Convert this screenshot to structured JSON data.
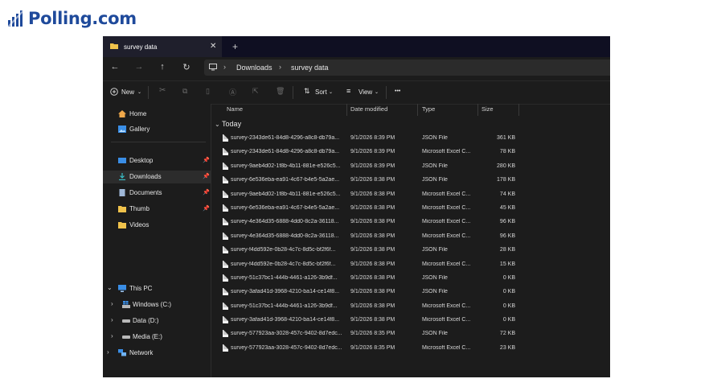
{
  "brand": {
    "text": "Polling.com",
    "color": "#1f4a9b"
  },
  "tab": {
    "title": "survey data",
    "close": "✕",
    "new": "+"
  },
  "nav": {
    "back": "←",
    "forward": "→",
    "up": "↑",
    "refresh": "↻"
  },
  "breadcrumb": {
    "parts": [
      "Downloads",
      "survey data"
    ],
    "sep": "›"
  },
  "toolbar": {
    "new_label": "New",
    "sort_label": "Sort",
    "view_label": "View",
    "more_label": "•••"
  },
  "sidebar": {
    "items": [
      {
        "label": "Home"
      },
      {
        "label": "Gallery"
      },
      {
        "label": "Desktop"
      },
      {
        "label": "Downloads"
      },
      {
        "label": "Documents"
      },
      {
        "label": "Thumb"
      },
      {
        "label": "Videos"
      },
      {
        "label": "This PC"
      },
      {
        "label": "Windows  (C:)"
      },
      {
        "label": "Data (D:)"
      },
      {
        "label": "Media (E:)"
      },
      {
        "label": "Network"
      }
    ]
  },
  "columns": {
    "name": "Name",
    "date": "Date modified",
    "type": "Type",
    "size": "Size"
  },
  "group_label": "Today",
  "files": [
    {
      "name": "survey-2343de61-84d8-4296-a8c8-db79a...",
      "date": "9/1/2026 8:39 PM",
      "type": "JSON File",
      "size": "361 KB"
    },
    {
      "name": "survey-2343de61-84d8-4296-a8c8-db79a...",
      "date": "9/1/2026 8:39 PM",
      "type": "Microsoft Excel C...",
      "size": "78 KB"
    },
    {
      "name": "survey-9aeb4d02-1f8b-4b11-881e-e526c5...",
      "date": "9/1/2026 8:39 PM",
      "type": "JSON File",
      "size": "280 KB"
    },
    {
      "name": "survey-6e536eba-ea91-4c67-b4e5-5a2ae...",
      "date": "9/1/2026 8:38 PM",
      "type": "JSON File",
      "size": "178 KB"
    },
    {
      "name": "survey-9aeb4d02-1f8b-4b11-881e-e526c5...",
      "date": "9/1/2026 8:38 PM",
      "type": "Microsoft Excel C...",
      "size": "74 KB"
    },
    {
      "name": "survey-6e536eba-ea91-4c67-b4e5-5a2ae...",
      "date": "9/1/2026 8:38 PM",
      "type": "Microsoft Excel C...",
      "size": "45 KB"
    },
    {
      "name": "survey-4e364d35-6888-4dd0-8c2a-36118...",
      "date": "9/1/2026 8:38 PM",
      "type": "Microsoft Excel C...",
      "size": "96 KB"
    },
    {
      "name": "survey-4e364d35-6888-4dd0-8c2a-36118...",
      "date": "9/1/2026 8:38 PM",
      "type": "Microsoft Excel C...",
      "size": "96 KB"
    },
    {
      "name": "survey-f4dd592e-0b28-4c7c-8d5c-bf2f6f...",
      "date": "9/1/2026 8:38 PM",
      "type": "JSON File",
      "size": "28 KB"
    },
    {
      "name": "survey-f4dd592e-0b28-4c7c-8d5c-bf2f6f...",
      "date": "9/1/2026 8:38 PM",
      "type": "Microsoft Excel C...",
      "size": "15 KB"
    },
    {
      "name": "survey-51c37bc1-444b-4461-a126-3b9df...",
      "date": "9/1/2026 8:38 PM",
      "type": "JSON File",
      "size": "0 KB"
    },
    {
      "name": "survey-3afad41d-3968-4210-ba14-ce14f8...",
      "date": "9/1/2026 8:38 PM",
      "type": "JSON File",
      "size": "0 KB"
    },
    {
      "name": "survey-51c37bc1-444b-4461-a126-3b9df...",
      "date": "9/1/2026 8:38 PM",
      "type": "Microsoft Excel C...",
      "size": "0 KB"
    },
    {
      "name": "survey-3afad41d-3968-4210-ba14-ce14f8...",
      "date": "9/1/2026 8:38 PM",
      "type": "Microsoft Excel C...",
      "size": "0 KB"
    },
    {
      "name": "survey-577923aa-3028-457c-9402-8d7edc...",
      "date": "9/1/2026 8:35 PM",
      "type": "JSON File",
      "size": "72 KB"
    },
    {
      "name": "survey-577923aa-3028-457c-9402-8d7edc...",
      "date": "9/1/2026 8:35 PM",
      "type": "Microsoft Excel C...",
      "size": "23 KB"
    }
  ],
  "colors": {
    "window_bg": "#1c1c1c",
    "titlebar_bg": "#0f0f22",
    "folder_yellow": "#f0c24b",
    "accent_blue": "#3a8ee6"
  }
}
